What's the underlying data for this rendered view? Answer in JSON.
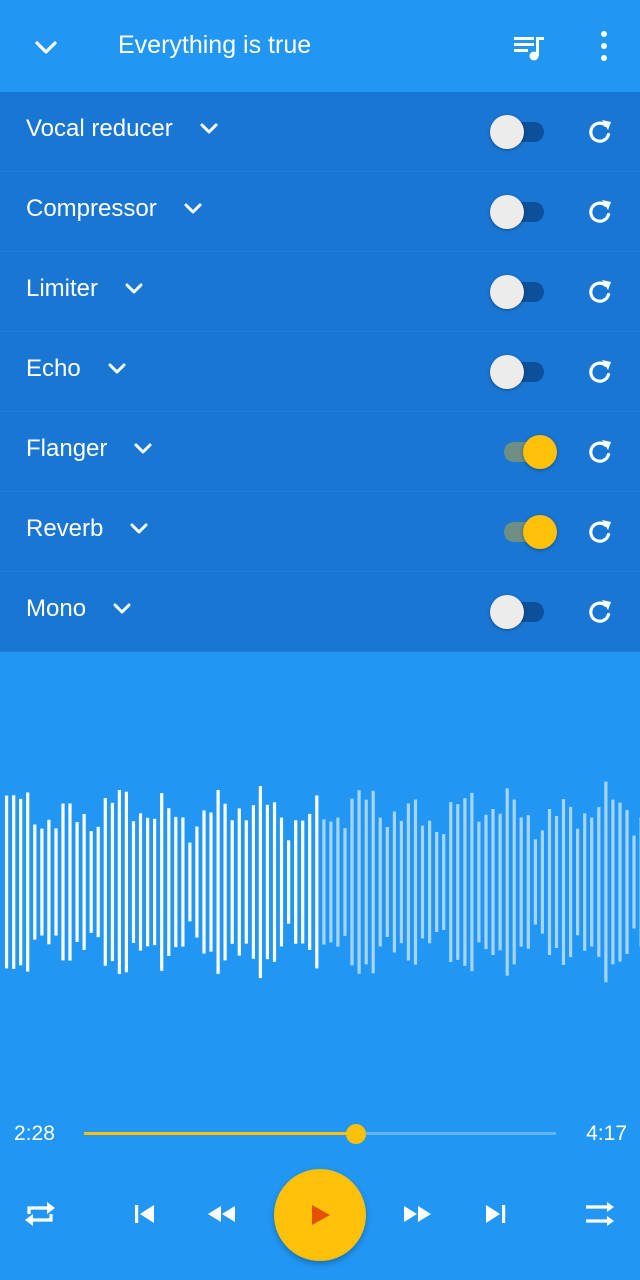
{
  "header": {
    "title": "Everything is true",
    "icons": [
      "chevron-down-icon",
      "queue-music-icon",
      "more-vert-icon"
    ]
  },
  "effects": [
    {
      "label": "Vocal reducer",
      "enabled": false
    },
    {
      "label": "Compressor",
      "enabled": false
    },
    {
      "label": "Limiter",
      "enabled": false
    },
    {
      "label": "Echo",
      "enabled": false
    },
    {
      "label": "Flanger",
      "enabled": true
    },
    {
      "label": "Reverb",
      "enabled": true
    },
    {
      "label": "Mono",
      "enabled": false
    }
  ],
  "player": {
    "current_time": "2:28",
    "total_time": "4:17",
    "progress_fraction": 0.576
  },
  "colors": {
    "background": "#2196f3",
    "effects_panel": "#1976d2",
    "accent": "#ffc107",
    "play_icon": "#e65100"
  },
  "controls": [
    "repeat-icon",
    "skip-previous-icon",
    "rewind-icon",
    "play-icon",
    "fast-forward-icon",
    "skip-next-icon",
    "shuffle-icon"
  ]
}
